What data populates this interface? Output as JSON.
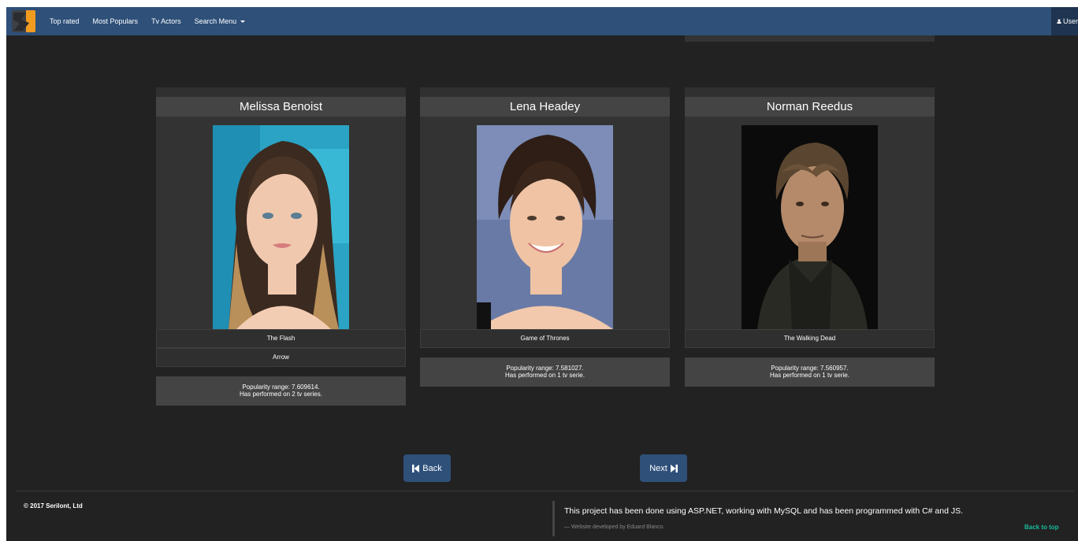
{
  "navbar": {
    "links": [
      "Top rated",
      "Most Populars",
      "Tv Actors"
    ],
    "search_menu": "Search Menu",
    "user_label": "User",
    "brand_color": "#2e5079",
    "logo_accent": "#f19b1f"
  },
  "actors": [
    {
      "name": "Melissa Benoist",
      "series": [
        "The Flash",
        "Arrow"
      ],
      "popularity": "Popularity range: 7.609614.",
      "performed": "Has performed on 2 tv series."
    },
    {
      "name": "Lena Headey",
      "series": [
        "Game of Thrones"
      ],
      "popularity": "Popularity range: 7.581027.",
      "performed": "Has performed on 1 tv serie."
    },
    {
      "name": "Norman Reedus",
      "series": [
        "The Walking Dead"
      ],
      "popularity": "Popularity range: 7.560957.",
      "performed": "Has performed on 1 tv serie."
    }
  ],
  "pagination": {
    "back_label": "Back",
    "next_label": "Next"
  },
  "footer": {
    "copyright": "© 2017 Serilont, Ltd",
    "quote": "This project has been done using ASP.NET, working with MySQL and has been programmed with C# and JS.",
    "quote_footer": "— Website developed by Eduard Blanco.",
    "back_to_top": "Back to top",
    "link_color": "#18bc9c"
  },
  "icons": {
    "user": "user-icon",
    "back": "step-backward-icon",
    "next": "step-forward-icon",
    "caret": "caret-down-icon"
  }
}
